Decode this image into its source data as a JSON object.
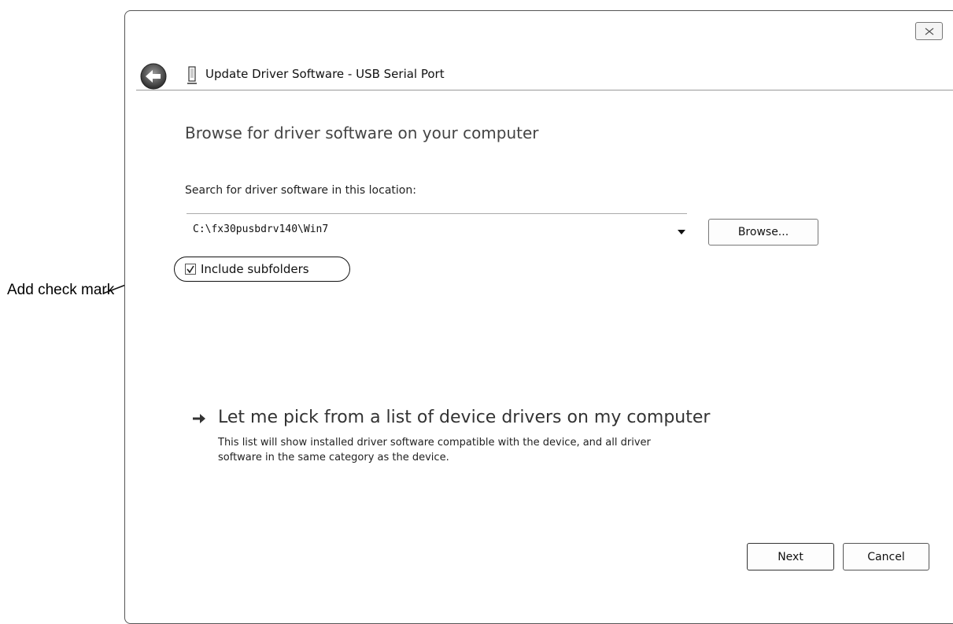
{
  "annotation": {
    "label": "Add check mark"
  },
  "window": {
    "title": "Update Driver Software - USB Serial Port",
    "heading": "Browse for driver software on your computer",
    "search_label": "Search for driver software in this location:",
    "path_value": "C:\\fx30pusbdrv140\\Win7",
    "browse_label": "Browse...",
    "include_subfolders": {
      "label": "Include subfolders",
      "checked": true
    },
    "pick_link": {
      "title": "Let me pick from a list of device drivers on my computer",
      "description": "This list will show installed driver software compatible with the device, and all driver software in the same category as the device."
    },
    "buttons": {
      "next": "Next",
      "cancel": "Cancel"
    }
  },
  "icons": {
    "back": "back-arrow-icon",
    "close": "close-icon",
    "device": "usb-device-icon",
    "link_arrow": "right-arrow-icon"
  }
}
